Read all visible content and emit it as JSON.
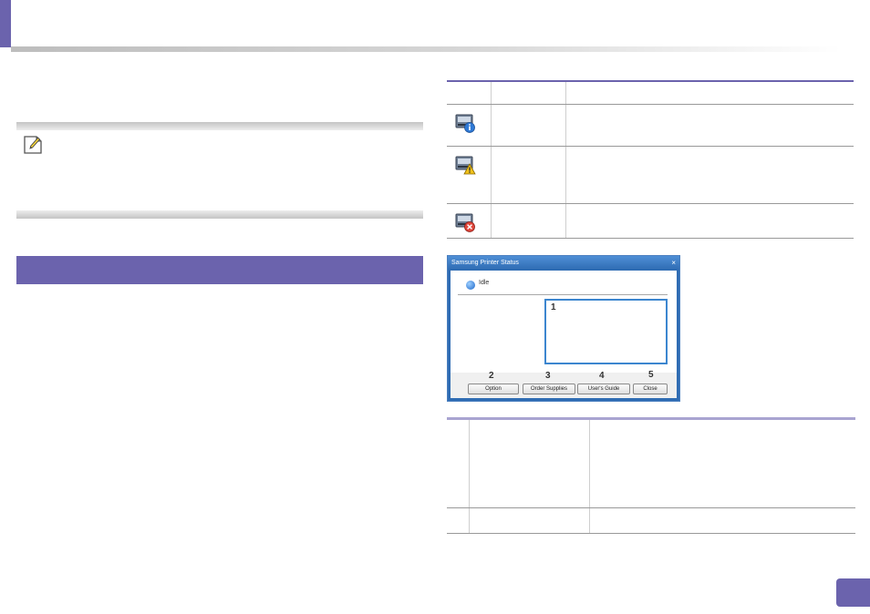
{
  "dialog": {
    "title": "Samsung Printer Status",
    "close_glyph": "×",
    "status_text": "Idle",
    "buttons": {
      "option": "Option",
      "order_supplies": "Order Supplies",
      "users_guide": "User's Guide",
      "close": "Close"
    },
    "callouts": [
      "1",
      "2",
      "3",
      "4",
      "5"
    ]
  },
  "icons": {
    "note": "pencil-note-icon",
    "status_info": "printer-info-icon",
    "status_warning": "printer-warning-icon",
    "status_error": "printer-error-icon"
  },
  "colors": {
    "accent": "#6b63ad",
    "dialog_frame": "#2f6cb3",
    "info_blue": "#2f7ad6",
    "warning_yellow": "#f2c21b",
    "error_red": "#e0463b"
  }
}
